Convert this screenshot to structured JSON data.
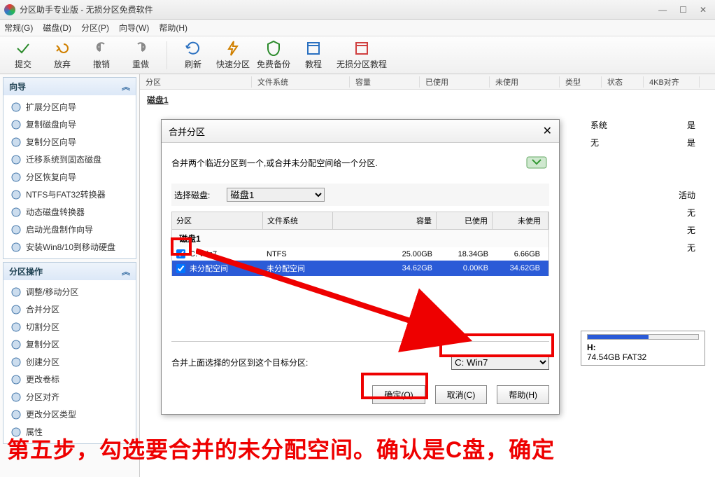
{
  "title": "分区助手专业版 - 无损分区免费软件",
  "menu": [
    "常规(G)",
    "磁盘(D)",
    "分区(P)",
    "向导(W)",
    "帮助(H)"
  ],
  "toolbar": [
    {
      "label": "提交",
      "icon": "check",
      "color": "#2a8a2a"
    },
    {
      "label": "放弃",
      "icon": "undo-all",
      "color": "#d08000"
    },
    {
      "label": "撤销",
      "icon": "undo",
      "color": "#888"
    },
    {
      "label": "重做",
      "icon": "redo",
      "color": "#888"
    },
    {
      "sep": true
    },
    {
      "label": "刷新",
      "icon": "refresh",
      "color": "#2a70c0"
    },
    {
      "label": "快速分区",
      "icon": "bolt",
      "color": "#d08000"
    },
    {
      "label": "免费备份",
      "icon": "shield",
      "color": "#2a8a2a"
    },
    {
      "label": "教程",
      "icon": "book",
      "color": "#2a70c0"
    },
    {
      "label": "无损分区教程",
      "icon": "book2",
      "color": "#d04040"
    }
  ],
  "main_headers": [
    "分区",
    "文件系统",
    "容量",
    "已使用",
    "未使用",
    "类型",
    "状态",
    "4KB对齐"
  ],
  "main_disk_label": "磁盘1",
  "wizard_panel": {
    "title": "向导",
    "items": [
      "扩展分区向导",
      "复制磁盘向导",
      "复制分区向导",
      "迁移系统到固态磁盘",
      "分区恢复向导",
      "NTFS与FAT32转换器",
      "动态磁盘转换器",
      "启动光盘制作向导",
      "安装Win8/10到移动硬盘"
    ]
  },
  "ops_panel": {
    "title": "分区操作",
    "items": [
      "调整/移动分区",
      "合并分区",
      "切割分区",
      "复制分区",
      "创建分区",
      "更改卷标",
      "分区对齐",
      "更改分区类型",
      "属性"
    ]
  },
  "right_info": {
    "r1a": "系统",
    "r1b": "是",
    "r2a": "无",
    "r2b": "是",
    "r3": "活动",
    "r4": "无",
    "r5": "无",
    "r6": "无"
  },
  "drive_h": {
    "label": "H:",
    "desc": "74.54GB FAT32"
  },
  "dialog": {
    "title": "合并分区",
    "desc": "合并两个临近分区到一个,或合并未分配空间给一个分区.",
    "select_disk_label": "选择磁盘:",
    "select_disk_value": "磁盘1",
    "headers": [
      "分区",
      "文件系统",
      "容量",
      "已使用",
      "未使用"
    ],
    "disk_sub": "磁盘1",
    "rows": [
      {
        "chk": true,
        "name": "C: Win7",
        "fs": "NTFS",
        "cap": "25.00GB",
        "used": "18.34GB",
        "free": "6.66GB",
        "sel": false
      },
      {
        "chk": true,
        "name": "未分配空间",
        "fs": "未分配空间",
        "cap": "34.62GB",
        "used": "0.00KB",
        "free": "34.62GB",
        "sel": true
      }
    ],
    "target_label": "合并上面选择的分区到这个目标分区:",
    "target_value": "C: Win7",
    "btn_ok": "确定(O)",
    "btn_cancel": "取消(C)",
    "btn_help": "帮助(H)"
  },
  "annotation": "第五步，勾选要合并的未分配空间。确认是C盘，确定"
}
